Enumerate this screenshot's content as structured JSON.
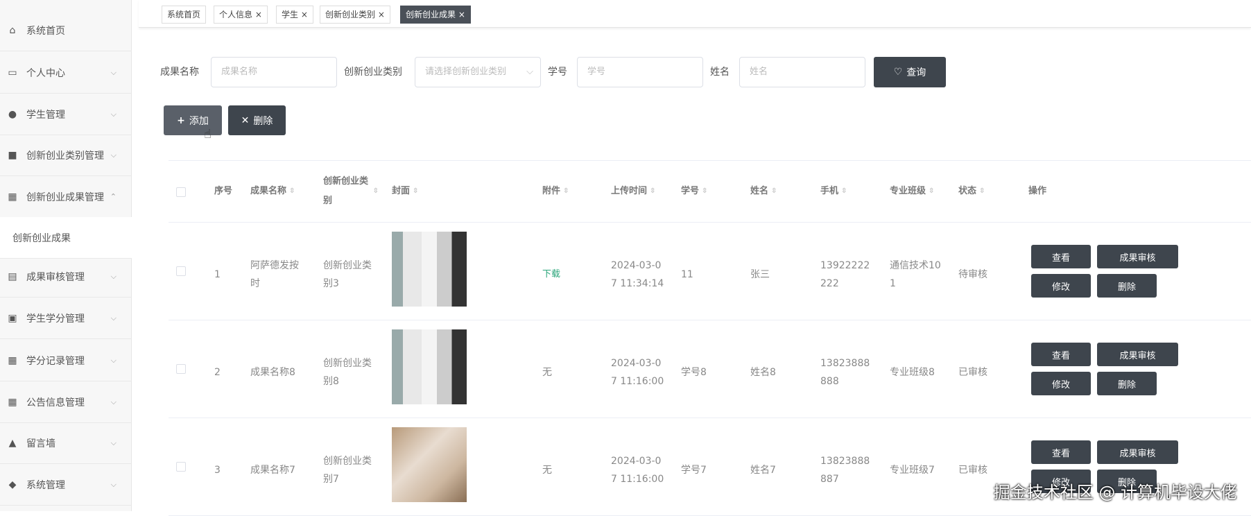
{
  "sidebar": {
    "items": [
      {
        "label": "系统首页",
        "icon": "home-icon"
      },
      {
        "label": "个人中心",
        "icon": "card-icon"
      },
      {
        "label": "学生管理",
        "icon": "bulb-icon"
      },
      {
        "label": "创新创业类别管理",
        "icon": "briefcase-icon"
      },
      {
        "label": "创新创业成果管理",
        "icon": "grid-icon"
      },
      {
        "label": "创新创业成果",
        "icon": ""
      },
      {
        "label": "成果审核管理",
        "icon": "clipboard-icon"
      },
      {
        "label": "学生学分管理",
        "icon": "clipboard-x-icon"
      },
      {
        "label": "学分记录管理",
        "icon": "grid-icon"
      },
      {
        "label": "公告信息管理",
        "icon": "grid-icon"
      },
      {
        "label": "留言墙",
        "icon": "user-icon"
      },
      {
        "label": "系统管理",
        "icon": "person-icon"
      }
    ]
  },
  "tabs": [
    "系统首页",
    "个人信息",
    "学生",
    "创新创业类别",
    "创新创业成果"
  ],
  "search": {
    "name_label": "成果名称",
    "name_placeholder": "成果名称",
    "type_label": "创新创业类别",
    "type_placeholder": "请选择创新创业类别",
    "id_label": "学号",
    "id_placeholder": "学号",
    "xm_label": "姓名",
    "xm_placeholder": "姓名",
    "query_label": "查询"
  },
  "toolbar": {
    "add_label": "添加",
    "delete_label": "删除"
  },
  "table": {
    "headers": [
      "序号",
      "成果名称",
      "创新创业类别",
      "封面",
      "附件",
      "上传时间",
      "学号",
      "姓名",
      "手机",
      "专业班级",
      "状态",
      "操作"
    ],
    "rows": [
      {
        "no": "1",
        "name": "阿萨德发按时",
        "type": "创新创业类别3",
        "attach": "下载",
        "time": "2024-03-07 11:34:14",
        "sid": "11",
        "sname": "张三",
        "phone": "13922222222",
        "cls": "通信技术101",
        "status": "待审核"
      },
      {
        "no": "2",
        "name": "成果名称8",
        "type": "创新创业类别8",
        "attach": "无",
        "time": "2024-03-07 11:16:00",
        "sid": "学号8",
        "sname": "姓名8",
        "phone": "13823888888",
        "cls": "专业班级8",
        "status": "已审核"
      },
      {
        "no": "3",
        "name": "成果名称7",
        "type": "创新创业类别7",
        "attach": "无",
        "time": "2024-03-07 11:16:00",
        "sid": "学号7",
        "sname": "姓名7",
        "phone": "13823888887",
        "cls": "专业班级7",
        "status": "已审核"
      }
    ],
    "actions": {
      "view": "查看",
      "review": "成果审核",
      "edit": "修改",
      "delete": "删除"
    }
  },
  "watermark": "掘金技术社区 @ 计算机毕设大佬",
  "colors": {
    "dark_button": "#3e454d",
    "link_green": "#2aa57a"
  }
}
